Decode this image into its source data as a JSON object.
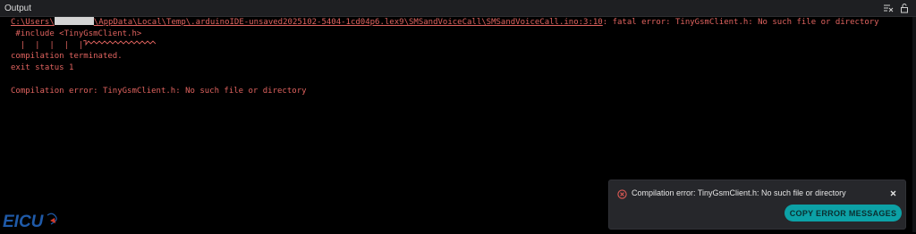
{
  "panel": {
    "title": "Output",
    "icons": [
      "clear-output-icon",
      "lock-scroll-icon"
    ]
  },
  "console": {
    "path_prefix": "C:\\Users\\",
    "path_suffix": "\\AppData\\Local\\Temp\\.arduinoIDE-unsaved2025102-5404-1cd04p6.lex9\\SMSandVoiceCall\\SMSandVoiceCall.ino:3:10",
    "error_text": ": fatal error: TinyGsmClient.h: No such file or directory",
    "include_line": " #include <TinyGsmClient.h>",
    "pipes_prefix": "  |  |  |  |  |",
    "terminated": "compilation terminated.",
    "exit_status": "exit status 1",
    "compilation_error": "Compilation error: TinyGsmClient.h: No such file or directory"
  },
  "toast": {
    "message": "Compilation error: TinyGsmClient.h: No such file or directory",
    "button_label": "COPY ERROR MESSAGES",
    "icons": [
      "error-circle-icon",
      "close-icon"
    ]
  },
  "logo": {
    "text": "EICU"
  },
  "colors": {
    "error_text": "#e0635f",
    "background": "#000000",
    "header_bg": "#1e1f22",
    "toast_bg": "#26272b",
    "button_bg": "#0ca1a6",
    "logo_blue": "#1f5aa8"
  }
}
